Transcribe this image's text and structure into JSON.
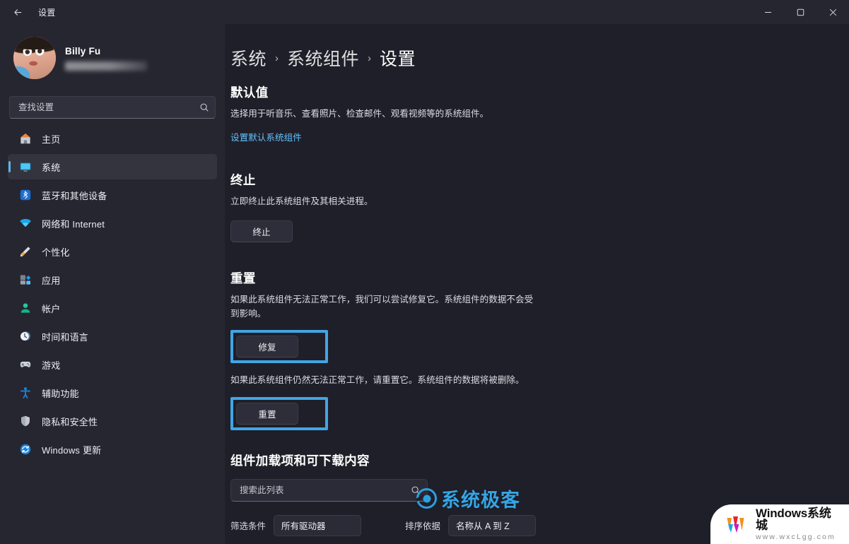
{
  "titlebar": {
    "title": "设置",
    "back_icon": "arrow-left-icon",
    "minimize_label": "—",
    "maximize_label": "▢",
    "close_label": "✕"
  },
  "account": {
    "name": "Billy Fu",
    "email_masked": ""
  },
  "search": {
    "placeholder": "查找设置",
    "value": "",
    "icon": "search-icon"
  },
  "sidebar": {
    "items": [
      {
        "label": "主页",
        "icon": "home-icon",
        "active": false
      },
      {
        "label": "系统",
        "icon": "display-icon",
        "active": true
      },
      {
        "label": "蓝牙和其他设备",
        "icon": "bluetooth-icon",
        "active": false
      },
      {
        "label": "网络和 Internet",
        "icon": "wifi-icon",
        "active": false
      },
      {
        "label": "个性化",
        "icon": "paintbrush-icon",
        "active": false
      },
      {
        "label": "应用",
        "icon": "apps-icon",
        "active": false
      },
      {
        "label": "帐户",
        "icon": "account-icon",
        "active": false
      },
      {
        "label": "时间和语言",
        "icon": "clock-icon",
        "active": false
      },
      {
        "label": "游戏",
        "icon": "gamepad-icon",
        "active": false
      },
      {
        "label": "辅助功能",
        "icon": "accessibility-icon",
        "active": false
      },
      {
        "label": "隐私和安全性",
        "icon": "shield-icon",
        "active": false
      },
      {
        "label": "Windows 更新",
        "icon": "update-icon",
        "active": false
      }
    ]
  },
  "breadcrumb": {
    "root": "系统",
    "sep": "›",
    "parent": "系统组件",
    "current": "设置"
  },
  "defaults": {
    "heading": "默认值",
    "description": "选择用于听音乐、查看照片、检查邮件、观看视频等的系统组件。",
    "link": "设置默认系统组件"
  },
  "terminate": {
    "heading": "终止",
    "description": "立即终止此系统组件及其相关进程。",
    "button": "终止"
  },
  "reset": {
    "heading": "重置",
    "repair_description": "如果此系统组件无法正常工作，我们可以尝试修复它。系统组件的数据不会受到影响。",
    "repair_button": "修复",
    "reset_description": "如果此系统组件仍然无法正常工作，请重置它。系统组件的数据将被删除。",
    "reset_button": "重置",
    "highlight_color": "#42a5e4"
  },
  "addons": {
    "heading": "组件加载项和可下载内容",
    "search_placeholder": "搜索此列表",
    "search_value": "",
    "filter_label": "筛选条件",
    "filter_value": "所有驱动器",
    "sort_label": "排序依据",
    "sort_value": "名称从 A 到 Z"
  },
  "watermarks": {
    "geek_text": "系统极客",
    "geek_color": "#35a5e4",
    "win_title": "Windows系统城",
    "win_url": "www.wxcLgg.com"
  }
}
